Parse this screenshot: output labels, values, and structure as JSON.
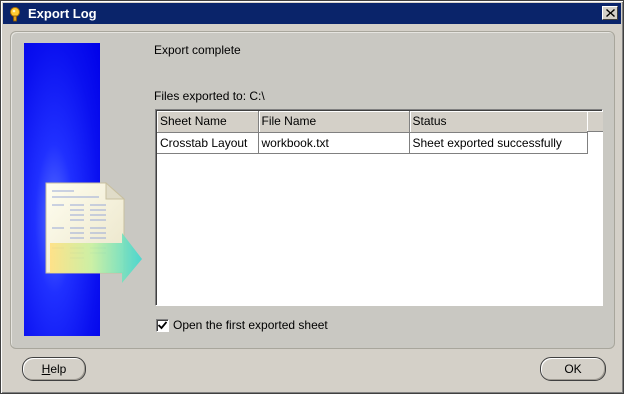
{
  "window": {
    "title": "Export Log"
  },
  "messages": {
    "status": "Export complete",
    "files_exported_to": "Files exported to: C:\\"
  },
  "table": {
    "columns": [
      "Sheet Name",
      "File Name",
      "Status"
    ],
    "rows": [
      [
        "Crosstab Layout",
        "workbook.txt",
        "Sheet exported successfully"
      ]
    ]
  },
  "checkbox": {
    "label": "Open the first exported sheet",
    "checked": true
  },
  "buttons": {
    "help_first": "H",
    "help_rest": "elp",
    "ok": "OK"
  },
  "icons": {
    "title_icon": "lightbulb-key-icon",
    "close_icon": "close-icon",
    "check_icon": "checkmark-icon",
    "side_image": "document-export-arrow-icon"
  },
  "colors": {
    "titlebar": "#0a246a",
    "side_panel": "#0000e8",
    "dialog_bg": "#d4d0c8"
  }
}
